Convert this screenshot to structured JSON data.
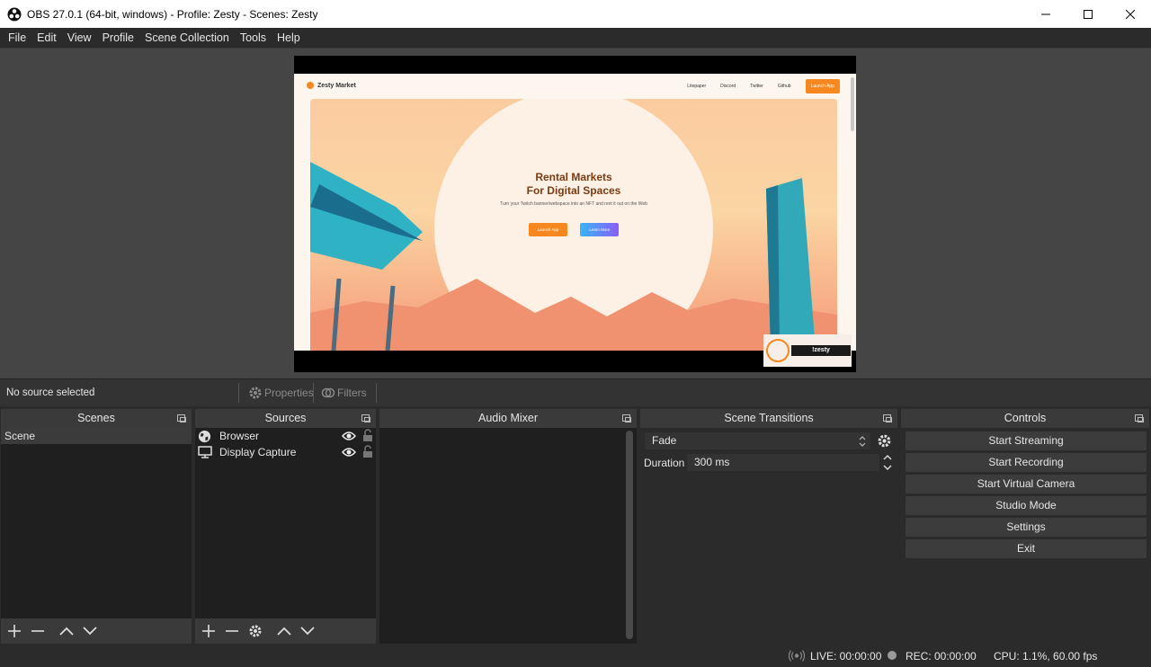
{
  "window": {
    "title": "OBS 27.0.1 (64-bit, windows) - Profile: Zesty - Scenes: Zesty"
  },
  "menu": [
    "File",
    "Edit",
    "View",
    "Profile",
    "Scene Collection",
    "Tools",
    "Help"
  ],
  "preview": {
    "site_brand": "Zesty Market",
    "nav_links": [
      "Litepaper",
      "Discord",
      "Twitter",
      "Github"
    ],
    "nav_launch": "Launch App",
    "hero_title_1": "Rental Markets",
    "hero_title_2": "For Digital Spaces",
    "hero_subtitle": "Turn your Twitch banner/webspace into an NFT and rent it out on the Web",
    "hero_btn_primary": "Launch App",
    "hero_btn_secondary": "Learn More",
    "overlay_tag": "!zesty"
  },
  "source_toolbar": {
    "status": "No source selected",
    "properties": "Properties",
    "filters": "Filters"
  },
  "scenes": {
    "title": "Scenes",
    "items": [
      "Scene"
    ]
  },
  "sources": {
    "title": "Sources",
    "items": [
      {
        "name": "Browser",
        "icon": "globe-icon"
      },
      {
        "name": "Display Capture",
        "icon": "monitor-icon"
      }
    ]
  },
  "audio_mixer": {
    "title": "Audio Mixer"
  },
  "transitions": {
    "title": "Scene Transitions",
    "selected": "Fade",
    "duration_label": "Duration",
    "duration_value": "300 ms"
  },
  "controls": {
    "title": "Controls",
    "buttons": [
      "Start Streaming",
      "Start Recording",
      "Start Virtual Camera",
      "Studio Mode",
      "Settings",
      "Exit"
    ]
  },
  "status": {
    "live": "LIVE: 00:00:00",
    "rec": "REC: 00:00:00",
    "cpu": "CPU: 1.1%, 60.00 fps"
  }
}
